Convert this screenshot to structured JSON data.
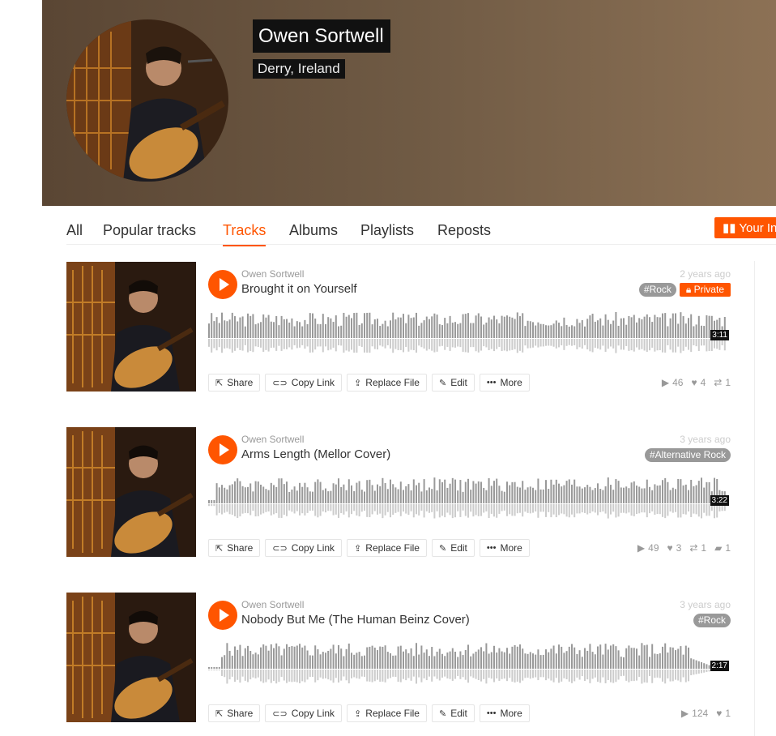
{
  "profile": {
    "name": "Owen Sortwell",
    "location": "Derry, Ireland"
  },
  "tabs": [
    {
      "label": "All",
      "active": false
    },
    {
      "label": "Popular tracks",
      "active": false
    },
    {
      "label": "Tracks",
      "active": true
    },
    {
      "label": "Albums",
      "active": false
    },
    {
      "label": "Playlists",
      "active": false
    },
    {
      "label": "Reposts",
      "active": false
    }
  ],
  "insights_label": "Your In",
  "accent_color": "#ff5500",
  "tracks": [
    {
      "artist": "Owen Sortwell",
      "title": "Brought it on Yourself",
      "date": "2 years ago",
      "tags": [
        "#Rock"
      ],
      "private_label": "Private",
      "duration": "3:11",
      "actions": [
        "Share",
        "Copy Link",
        "Replace File",
        "Edit",
        "More"
      ],
      "plays": "46",
      "likes": "4",
      "reposts": "1",
      "comments": ""
    },
    {
      "artist": "Owen Sortwell",
      "title": "Arms Length (Mellor Cover)",
      "date": "3 years ago",
      "tags": [
        "#Alternative Rock"
      ],
      "private_label": "",
      "duration": "3:22",
      "actions": [
        "Share",
        "Copy Link",
        "Replace File",
        "Edit",
        "More"
      ],
      "plays": "49",
      "likes": "3",
      "reposts": "1",
      "comments": "1"
    },
    {
      "artist": "Owen Sortwell",
      "title": "Nobody But Me (The Human Beinz Cover)",
      "date": "3 years ago",
      "tags": [
        "#Rock"
      ],
      "private_label": "",
      "duration": "2:17",
      "actions": [
        "Share",
        "Copy Link",
        "Replace File",
        "Edit",
        "More"
      ],
      "plays": "124",
      "likes": "1",
      "reposts": "",
      "comments": ""
    }
  ]
}
